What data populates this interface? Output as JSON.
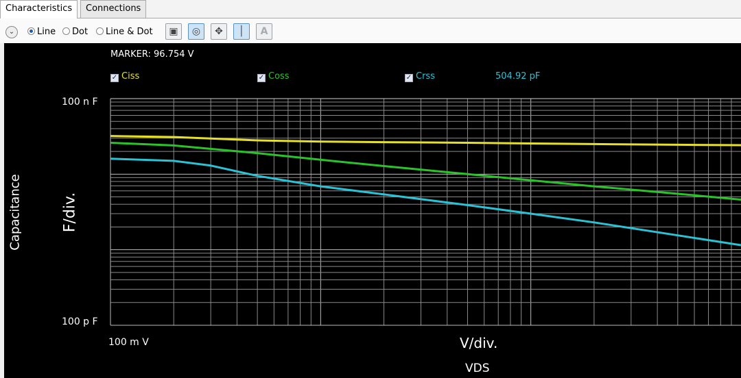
{
  "tabs": [
    {
      "label": "Characteristics",
      "active": true
    },
    {
      "label": "Connections",
      "active": false
    }
  ],
  "toolbar": {
    "radio_line": "Line",
    "radio_dot": "Dot",
    "radio_linedot": "Line & Dot",
    "selected": "Line",
    "buttons": [
      "camera-icon",
      "target-icon",
      "move-icon",
      "marker-icon",
      "text-icon"
    ]
  },
  "marker": {
    "text": "MARKER: 96.754 V",
    "value_text": "504.92 pF"
  },
  "legend": [
    {
      "name": "Ciss",
      "color": "#e6e02a",
      "checked": true
    },
    {
      "name": "Coss",
      "color": "#2bc32b",
      "checked": true
    },
    {
      "name": "Crss",
      "color": "#2ac3d6",
      "checked": true
    }
  ],
  "axes": {
    "y_top_label": "100 n F",
    "y_bottom_label": "100 p F",
    "x_left_label": "100 m V",
    "y_div": "F/div.",
    "x_div": "V/div.",
    "y_title": "Capacitance",
    "x_title": "VDS"
  },
  "chart_data": {
    "type": "line",
    "xscale": "log",
    "yscale": "log",
    "xlim": [
      0.1,
      100
    ],
    "ylim": [
      1e-10,
      1e-07
    ],
    "xunit": "V",
    "yunit": "F",
    "series": [
      {
        "name": "Ciss",
        "color": "#e6e02a",
        "x": [
          0.1,
          0.2,
          0.5,
          1,
          2,
          5,
          10,
          20,
          50,
          100
        ],
        "y": [
          3.2e-08,
          3.1e-08,
          2.8e-08,
          2.7e-08,
          2.65e-08,
          2.6e-08,
          2.55e-08,
          2.5e-08,
          2.45e-08,
          2.42e-08
        ]
      },
      {
        "name": "Coss",
        "color": "#2bc32b",
        "x": [
          0.1,
          0.2,
          0.5,
          1,
          2,
          5,
          10,
          20,
          50,
          100
        ],
        "y": [
          2.6e-08,
          2.4e-08,
          1.9e-08,
          1.55e-08,
          1.28e-08,
          1e-08,
          8.3e-09,
          6.9e-09,
          5.5e-09,
          4.6e-09
        ]
      },
      {
        "name": "Crss",
        "color": "#2ac3d6",
        "x": [
          0.1,
          0.2,
          0.3,
          0.5,
          1,
          2,
          5,
          10,
          20,
          50,
          100
        ],
        "y": [
          1.6e-08,
          1.5e-08,
          1.3e-08,
          9.5e-09,
          6.9e-09,
          5.4e-09,
          3.9e-09,
          3e-09,
          2.3e-09,
          1.55e-09,
          1.15e-09
        ]
      }
    ]
  }
}
